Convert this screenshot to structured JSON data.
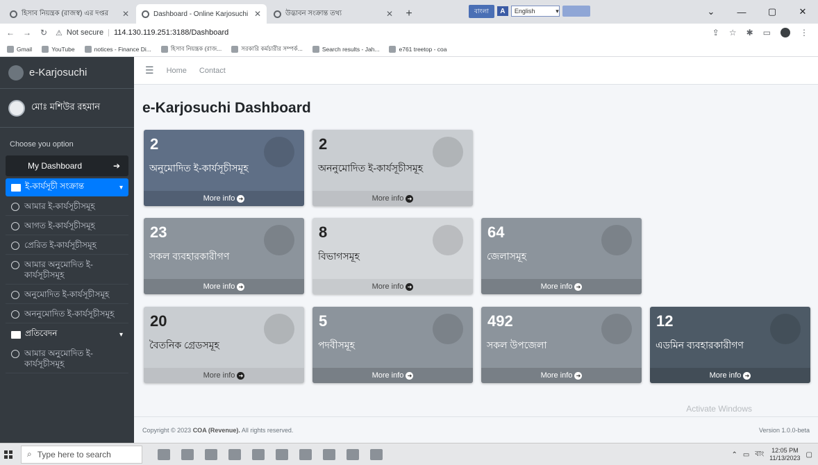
{
  "browser": {
    "tabs": [
      {
        "title": "হিসাব নিয়ন্ত্রক (রাজস্ব) এর দপ্তর",
        "active": false
      },
      {
        "title": "Dashboard - Online Karjosuchi",
        "active": true
      },
      {
        "title": "উদ্ভাবন সংক্রান্ত তথ্য",
        "active": false
      }
    ],
    "new_tab": "+",
    "lang_bar": {
      "label1": "বাংলা",
      "label2": "A",
      "input_lang": "English"
    },
    "address": {
      "warning": "Not secure",
      "url": "114.130.119.251:3188/Dashboard"
    },
    "bookmarks": [
      "Gmail",
      "YouTube",
      "notices - Finance Di...",
      "হিসাব নিয়ন্ত্রক (রাজ...",
      "সরকারি কর্মচারীর সম্পর্ক...",
      "Search results - Jah...",
      "e761 treetop - coa"
    ]
  },
  "sidebar": {
    "brand": "e-Karjosuchi",
    "user": "মোঃ মশিউর রহমান",
    "header": "Choose you option",
    "active_item": "My Dashboard",
    "group1": "ই-কার্যসূচী সংক্রান্ত",
    "items1": [
      "আমার ই-কার্যসূচীসমূহ",
      "আগত ই-কার্যসূচীসমূহ",
      "প্রেরিত ই-কার্যসূচীসমূহ",
      "আমার অনুমোদিত ই-কার্যসূচীসমূহ",
      "অনুমোদিত ই-কার্যসূচীসমূহ",
      "অননুমোদিত ই-কার্যসূচীসমূহ"
    ],
    "group2": "প্রতিবেদন",
    "items2": [
      "আমার অনুমোদিত ই-কার্যসূচীসমূহ"
    ]
  },
  "topnav": {
    "home": "Home",
    "contact": "Contact"
  },
  "page": {
    "title": "e-Karjosuchi Dashboard"
  },
  "more_info": "More info",
  "cards": [
    {
      "value": "2",
      "label": "অনুমোদিত ই-কার্যসূচীসমূহ"
    },
    {
      "value": "2",
      "label": "অননুমোদিত ই-কার্যসূচীসমূহ"
    },
    {
      "value": "23",
      "label": "সকল ব্যবহারকারীগণ"
    },
    {
      "value": "8",
      "label": "বিভাগসমূহ"
    },
    {
      "value": "64",
      "label": "জেলাসমূহ"
    },
    {
      "value": "20",
      "label": "বৈতনিক গ্রেডসমূহ"
    },
    {
      "value": "5",
      "label": "পদবীসমূহ"
    },
    {
      "value": "492",
      "label": "সকল উপজেলা"
    },
    {
      "value": "12",
      "label": "এডমিন ব্যবহারকারীগণ"
    }
  ],
  "footer": {
    "copyright_prefix": "Copyright © 2023",
    "org": "COA (Revenue).",
    "rights": "All rights reserved.",
    "version": "Version 1.0.0-beta"
  },
  "watermark": "Activate Windows",
  "taskbar": {
    "search_placeholder": "Type here to search",
    "lang": "বাং",
    "time": "12:05 PM",
    "date": "11/13/2023"
  }
}
